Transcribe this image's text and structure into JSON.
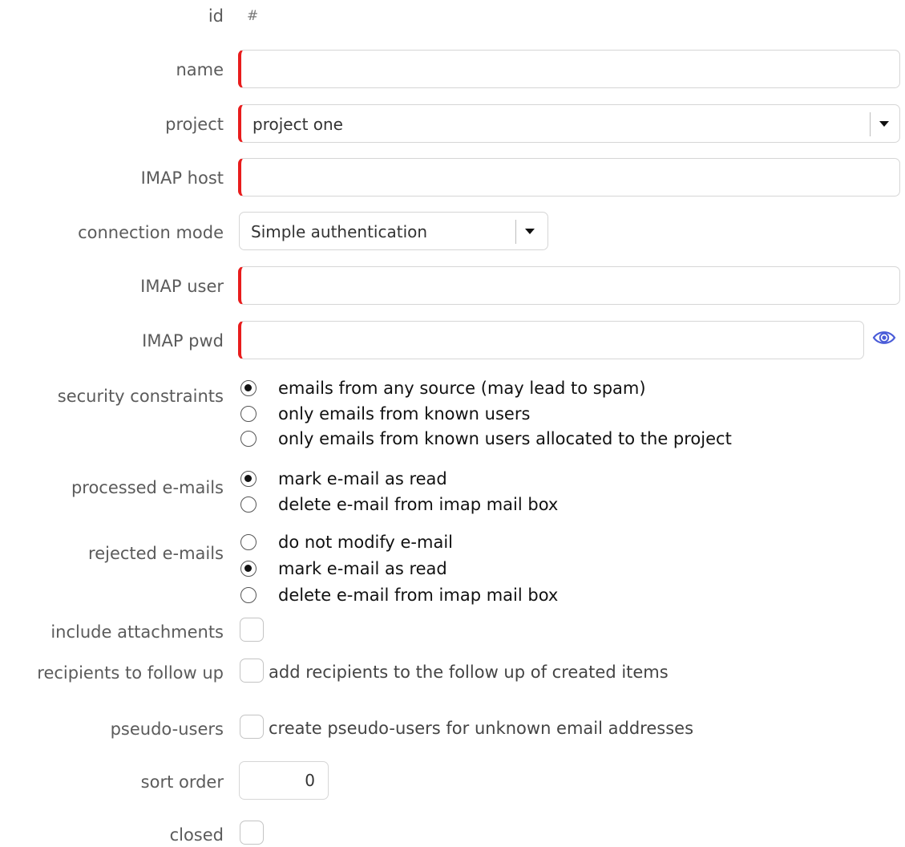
{
  "fields": {
    "id": {
      "label": "id",
      "value": "#"
    },
    "name": {
      "label": "name",
      "value": ""
    },
    "project": {
      "label": "project",
      "value": "project one"
    },
    "imap_host": {
      "label": "IMAP host",
      "value": ""
    },
    "connection_mode": {
      "label": "connection mode",
      "value": "Simple authentication"
    },
    "imap_user": {
      "label": "IMAP user",
      "value": ""
    },
    "imap_pwd": {
      "label": "IMAP pwd",
      "value": ""
    },
    "security_constraints": {
      "label": "security constraints",
      "options": [
        {
          "label": "emails from any source (may lead to spam)",
          "selected": true
        },
        {
          "label": "only emails from known users",
          "selected": false
        },
        {
          "label": "only emails from known users allocated to the project",
          "selected": false
        }
      ]
    },
    "processed_emails": {
      "label": "processed e-mails",
      "options": [
        {
          "label": "mark e-mail as read",
          "selected": true
        },
        {
          "label": "delete e-mail from imap mail box",
          "selected": false
        }
      ]
    },
    "rejected_emails": {
      "label": "rejected e-mails",
      "options": [
        {
          "label": "do not modify e-mail",
          "selected": false
        },
        {
          "label": "mark e-mail as read",
          "selected": true
        },
        {
          "label": "delete e-mail from imap mail box",
          "selected": false
        }
      ]
    },
    "include_attachments": {
      "label": "include attachments",
      "checked": false
    },
    "recipients_to_follow_up": {
      "label": "recipients to follow up",
      "text": "add recipients to the follow up of created items",
      "checked": false
    },
    "pseudo_users": {
      "label": "pseudo-users",
      "text": "create pseudo-users for unknown email addresses",
      "checked": false
    },
    "sort_order": {
      "label": "sort order",
      "value": "0"
    },
    "closed": {
      "label": "closed",
      "checked": false
    }
  },
  "colors": {
    "required_marker": "#e81c1c",
    "eye_icon": "#4a5cd8"
  },
  "icons": {
    "password_toggle": "eye-icon",
    "dropdown": "caret-down-icon"
  }
}
